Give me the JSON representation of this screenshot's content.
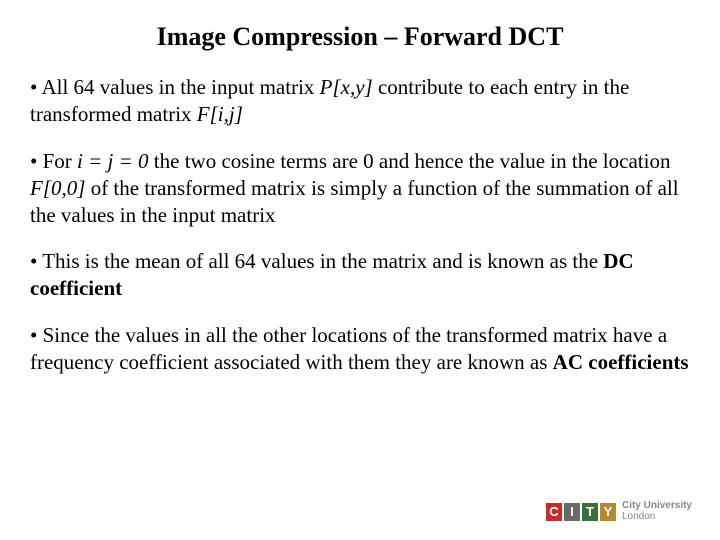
{
  "title": "Image Compression – Forward DCT",
  "bullets": {
    "b1a": "•   All 64 values in the input matrix ",
    "b1i1": "P[x,y]",
    "b1b": " contribute to each entry in the transformed matrix ",
    "b1i2": "F[i,j]",
    "b2a": "• For ",
    "b2i1": "i = j = 0",
    "b2b": " the two cosine terms are 0 and hence the value in the location ",
    "b2i2": "F[0,0]",
    "b2c": " of the transformed matrix is simply a function of the summation of all the values in the input matrix",
    "b3a": "• This is the mean of all 64 values in the matrix and is known as the ",
    "b3bold": "DC coefficient",
    "b4a": "• Since the values in all the other locations of the transformed matrix have a frequency coefficient associated with them they are known as ",
    "b4bold": "AC coefficients"
  },
  "logo": {
    "c": "C",
    "i": "I",
    "t": "T",
    "y": "Y",
    "uni1": "City University",
    "uni2": "London"
  }
}
